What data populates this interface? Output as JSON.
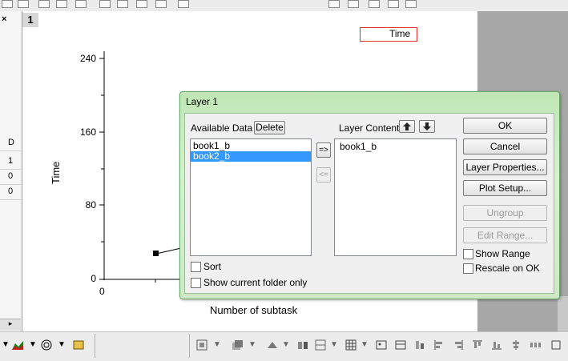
{
  "graph": {
    "window_number": "1",
    "legend_label": "Time",
    "y_axis_title": "Time",
    "x_axis_title": "Number of subtask",
    "y_ticks": [
      "240",
      "160",
      "80",
      "0"
    ],
    "x_ticks": [
      "0"
    ]
  },
  "worksheet": {
    "header": "D",
    "rows": [
      "1",
      "0",
      "0"
    ]
  },
  "dialog": {
    "title": "Layer 1",
    "available_label": "Available Data",
    "delete_label": "Delete",
    "available_items": [
      "book1_b",
      "book2_b"
    ],
    "selected_index": 1,
    "add_label": "=>",
    "remove_label": "<=",
    "layer_contents_label": "Layer Contents",
    "layer_items": [
      "book1_b"
    ],
    "ok_label": "OK",
    "cancel_label": "Cancel",
    "layer_properties_label": "Layer Properties...",
    "plot_setup_label": "Plot Setup...",
    "ungroup_label": "Ungroup",
    "edit_range_label": "Edit Range...",
    "sort_label": "Sort",
    "show_current_folder_label": "Show current folder only",
    "show_range_label": "Show Range",
    "rescale_label": "Rescale on OK"
  },
  "colors": {
    "dialog_accent": "#bfe6b5",
    "selection": "#3399ff",
    "legend_border": "#e23030"
  }
}
